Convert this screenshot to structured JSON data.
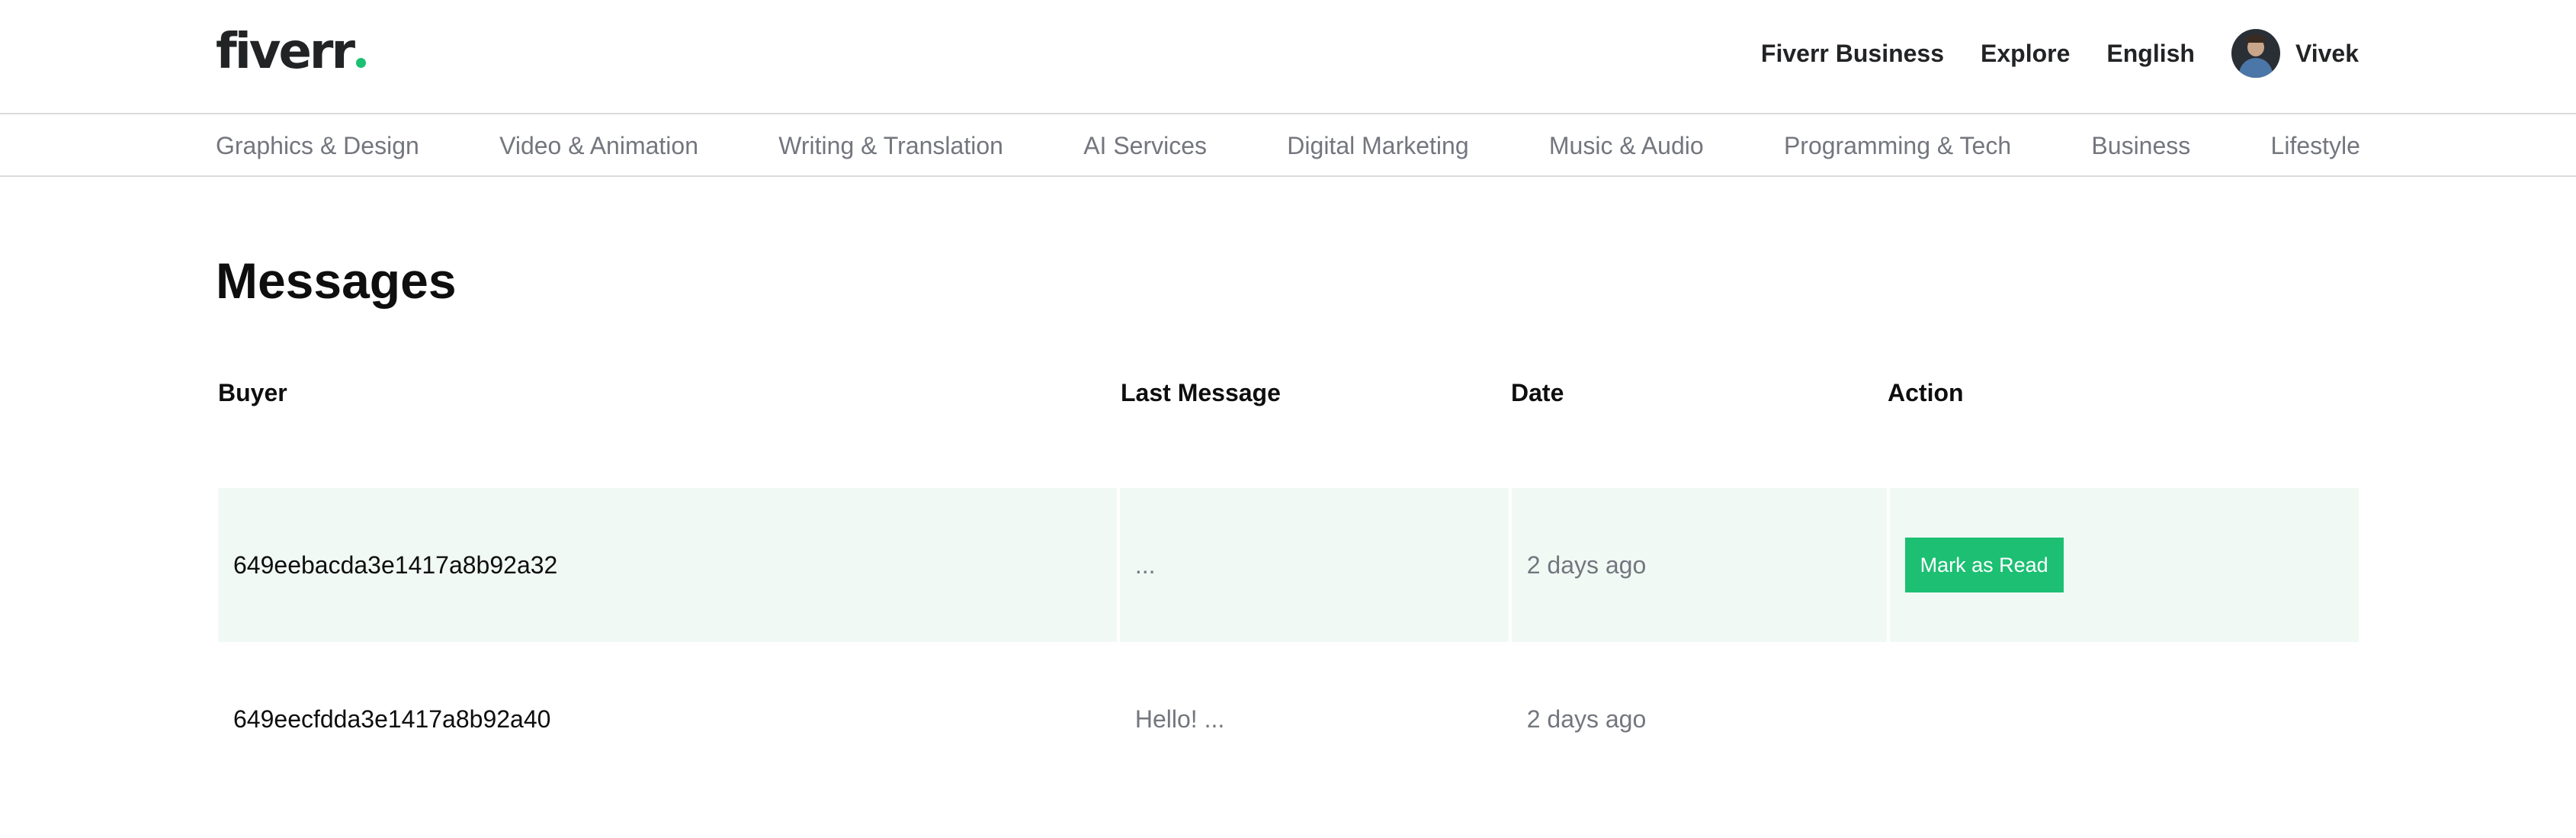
{
  "brand": {
    "name": "fiverr",
    "dot_color": "#1dbf73"
  },
  "header": {
    "links": [
      "Fiverr Business",
      "Explore",
      "English"
    ],
    "user_name": "Vivek"
  },
  "categories": [
    "Graphics & Design",
    "Video & Animation",
    "Writing & Translation",
    "AI Services",
    "Digital Marketing",
    "Music & Audio",
    "Programming & Tech",
    "Business",
    "Lifestyle"
  ],
  "page": {
    "title": "Messages"
  },
  "table": {
    "headers": {
      "buyer": "Buyer",
      "last_message": "Last Message",
      "date": "Date",
      "action": "Action"
    },
    "rows": [
      {
        "buyer": "649eebacda3e1417a8b92a32",
        "last_message": "...",
        "date": "2 days ago",
        "action": "Mark as Read",
        "unread": true
      },
      {
        "buyer": "649eecfdda3e1417a8b92a40",
        "last_message": "Hello! ...",
        "date": "2 days ago",
        "action": "",
        "unread": false
      }
    ]
  },
  "colors": {
    "accent": "#1dbf73",
    "unread_row_bg": "#f1f9f5",
    "muted_text": "#74767e"
  }
}
